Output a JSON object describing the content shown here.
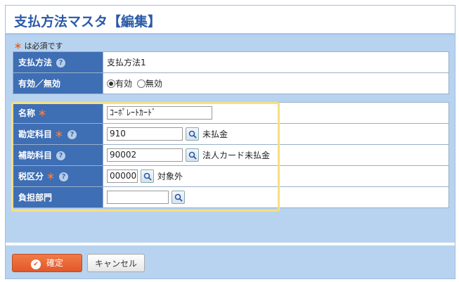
{
  "page": {
    "title": "支払方法マスタ【編集】",
    "required_star": "＊",
    "required_note": "は必須です"
  },
  "top_section": {
    "payment_method": {
      "label": "支払方法",
      "value": "支払方法1"
    },
    "active": {
      "label": "有効／無効",
      "options": [
        {
          "label": "有効",
          "selected": true
        },
        {
          "label": "無効",
          "selected": false
        }
      ]
    }
  },
  "edit_section": {
    "name": {
      "label": "名称",
      "value": "ｺｰﾎﾟﾚｰﾄｶｰﾄﾞ"
    },
    "account": {
      "label": "勘定科目",
      "code": "910",
      "display": "未払金"
    },
    "sub_account": {
      "label": "補助科目",
      "code": "90002",
      "display": "法人カード未払金"
    },
    "tax_category": {
      "label": "税区分",
      "code": "00000",
      "display": "対象外"
    },
    "department": {
      "label": "負担部門",
      "code": ""
    }
  },
  "buttons": {
    "confirm": "確定",
    "cancel": "キャンセル"
  },
  "icons": {
    "help": "?",
    "search": "magnifier-icon"
  },
  "colors": {
    "label_bg": "#3e6eb4",
    "page_bg": "#b8d3ef",
    "accent_orange": "#e2582a",
    "highlight": "#f5df85"
  }
}
